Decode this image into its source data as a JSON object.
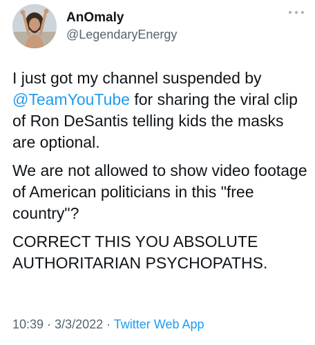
{
  "user": {
    "display_name": "AnOmaly",
    "handle": "@LegendaryEnergy"
  },
  "tweet": {
    "p1_before": "I just got my channel suspended by ",
    "p1_mention": "@TeamYouTube",
    "p1_after": " for sharing the viral clip of Ron DeSantis telling kids the masks are optional.",
    "p2": "We are not allowed to show video footage of American politicians in this \"free country\"?",
    "p3": "CORRECT THIS YOU ABSOLUTE AUTHORITARIAN PSYCHOPATHS."
  },
  "meta": {
    "time": "10:39",
    "sep1": " · ",
    "date": "3/3/2022",
    "sep2": " · ",
    "source": "Twitter Web App"
  },
  "icons": {
    "more": "more-options-icon"
  },
  "colors": {
    "link": "#1d9bf0",
    "secondary_text": "#536471",
    "primary_text": "#0f1419"
  }
}
